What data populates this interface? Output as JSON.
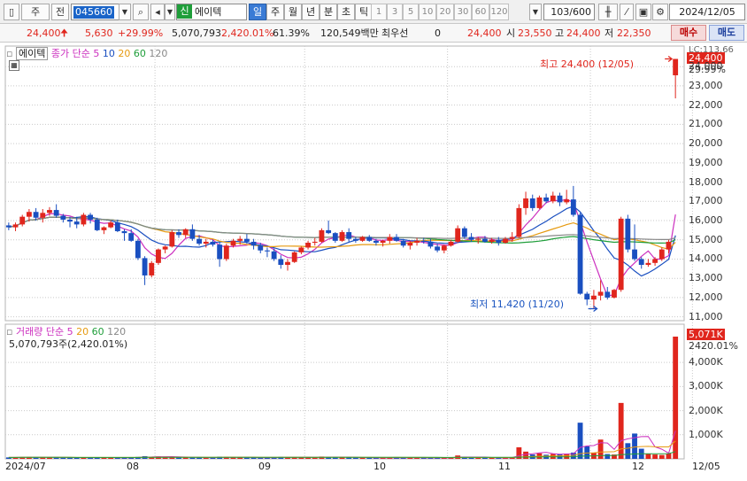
{
  "toolbar": {
    "market": "주",
    "scope": "전",
    "code": "045660",
    "stock_badge": "신",
    "stock_name": "에이텍",
    "periods": [
      "일",
      "주",
      "월",
      "년",
      "분",
      "초",
      "틱"
    ],
    "active_period": "일",
    "minutes": [
      "1",
      "3",
      "5",
      "10",
      "20",
      "30",
      "60",
      "120"
    ],
    "count_display": "103/600",
    "date": "2024/12/05"
  },
  "quote": {
    "price": "24,400",
    "change": "5,630",
    "change_pct": "+29.99%",
    "volume": "5,070,793",
    "volume_pct": "2,420.01%",
    "turnover": "61.39%",
    "amount": "120,549백만",
    "priority_label": "최우선",
    "priority_value": "0",
    "current": "24,400",
    "open_label": "시",
    "open": "23,550",
    "high_label": "고",
    "high": "24,400",
    "low_label": "저",
    "low": "22,350",
    "buy": "매수",
    "sell": "매도"
  },
  "price_panel": {
    "name": "에이텍",
    "ma_type": "종가 단순",
    "ma_periods": [
      "5",
      "10",
      "20",
      "60",
      "120"
    ],
    "ma_colors": [
      "#cc2fbf",
      "#1a4fc0",
      "#e69a10",
      "#1f9e3a",
      "#888888"
    ],
    "high_note": "최고 24,400 (12/05)",
    "low_note": "최저 11,420 (11/20)",
    "axis_ticks": [
      "24,000",
      "23,000",
      "22,000",
      "21,000",
      "20,000",
      "19,000",
      "18,000",
      "17,000",
      "16,000",
      "15,000",
      "14,000",
      "13,000",
      "12,000",
      "11,000"
    ],
    "lc_label": "LC:113.66",
    "current_tag": "24,400",
    "pct_tag": "29.99%"
  },
  "volume_panel": {
    "title": "거래량",
    "ma_type": "단순",
    "ma_periods": [
      "5",
      "20",
      "60",
      "120"
    ],
    "ma_colors": [
      "#cc2fbf",
      "#e69a10",
      "#1f9e3a",
      "#888888"
    ],
    "summary": "5,070,793주(2,420.01%)",
    "current_tag": "5,071K",
    "pct_tag": "2420.01%",
    "axis_ticks": [
      "4,000K",
      "3,000K",
      "2,000K",
      "1,000K"
    ]
  },
  "x_axis": [
    "2024/07",
    "08",
    "09",
    "10",
    "11",
    "12",
    "12/05"
  ],
  "chart_data": {
    "type": "candlestick",
    "series_name": "에이텍",
    "y_range": [
      10800,
      24700
    ],
    "volume_range": [
      0,
      5071
    ],
    "candles": [
      [
        15750,
        15900,
        15500,
        15650
      ],
      [
        15650,
        15900,
        15450,
        15800
      ],
      [
        15800,
        16300,
        15700,
        16200
      ],
      [
        16200,
        16600,
        15950,
        16450
      ],
      [
        16450,
        16650,
        16000,
        16150
      ],
      [
        16150,
        16600,
        15900,
        16400
      ],
      [
        16400,
        16700,
        16250,
        16550
      ],
      [
        16550,
        16850,
        16150,
        16250
      ],
      [
        16250,
        16350,
        15900,
        16050
      ],
      [
        16050,
        16200,
        15650,
        15950
      ],
      [
        15950,
        16200,
        15600,
        15800
      ],
      [
        15800,
        16400,
        15700,
        16300
      ],
      [
        16300,
        16400,
        15850,
        16050
      ],
      [
        16050,
        16150,
        15450,
        15500
      ],
      [
        15500,
        15700,
        15300,
        15650
      ],
      [
        15650,
        16000,
        15600,
        15900
      ],
      [
        15900,
        16050,
        15400,
        15450
      ],
      [
        15450,
        15550,
        14950,
        15350
      ],
      [
        15350,
        15550,
        14900,
        14950
      ],
      [
        14950,
        15050,
        13950,
        14050
      ],
      [
        14050,
        14150,
        12650,
        13150
      ],
      [
        13150,
        13900,
        13050,
        13800
      ],
      [
        13800,
        14550,
        13700,
        14500
      ],
      [
        14500,
        14700,
        14300,
        14650
      ],
      [
        14650,
        15500,
        14600,
        15400
      ],
      [
        15400,
        15550,
        15100,
        15250
      ],
      [
        15250,
        15600,
        15100,
        15550
      ],
      [
        15550,
        15800,
        14950,
        15050
      ],
      [
        15050,
        15250,
        14700,
        14800
      ],
      [
        14800,
        15050,
        14600,
        14900
      ],
      [
        14900,
        15000,
        14650,
        14750
      ],
      [
        14750,
        14900,
        13600,
        14000
      ],
      [
        14000,
        14800,
        13900,
        14700
      ],
      [
        14700,
        15050,
        14600,
        14950
      ],
      [
        14950,
        15200,
        14750,
        15050
      ],
      [
        15050,
        15300,
        14800,
        14900
      ],
      [
        14900,
        15050,
        14500,
        14700
      ],
      [
        14700,
        14850,
        14300,
        14450
      ],
      [
        14450,
        14600,
        14100,
        14400
      ],
      [
        14400,
        14550,
        13900,
        14000
      ],
      [
        14000,
        14200,
        13500,
        13700
      ],
      [
        13700,
        14000,
        13400,
        13850
      ],
      [
        13850,
        14400,
        13800,
        14350
      ],
      [
        14350,
        14650,
        14250,
        14600
      ],
      [
        14600,
        14950,
        14500,
        14850
      ],
      [
        14850,
        15100,
        14700,
        14900
      ],
      [
        14900,
        15600,
        14850,
        15500
      ],
      [
        15500,
        16000,
        15300,
        15350
      ],
      [
        15350,
        15400,
        14850,
        14950
      ],
      [
        14950,
        15500,
        14900,
        15400
      ],
      [
        15400,
        15600,
        14900,
        15050
      ],
      [
        15050,
        15150,
        14850,
        14950
      ],
      [
        14950,
        15200,
        14900,
        15150
      ],
      [
        15150,
        15250,
        14900,
        14950
      ],
      [
        14950,
        15050,
        14700,
        14850
      ],
      [
        14850,
        15000,
        14650,
        14950
      ],
      [
        14950,
        15300,
        14800,
        15150
      ],
      [
        15150,
        15300,
        14900,
        14950
      ],
      [
        14950,
        15050,
        14600,
        14700
      ],
      [
        14700,
        14950,
        14500,
        14850
      ],
      [
        14850,
        15100,
        14700,
        14950
      ],
      [
        14950,
        15100,
        14800,
        14900
      ],
      [
        14900,
        15050,
        14550,
        14650
      ],
      [
        14650,
        14800,
        14350,
        14450
      ],
      [
        14450,
        14750,
        14300,
        14700
      ],
      [
        14700,
        15000,
        14650,
        14900
      ],
      [
        14900,
        15750,
        14850,
        15600
      ],
      [
        15600,
        15700,
        15050,
        15150
      ],
      [
        15150,
        15350,
        14900,
        15000
      ],
      [
        15000,
        15150,
        14800,
        15050
      ],
      [
        15050,
        15200,
        14850,
        14900
      ],
      [
        14900,
        15100,
        14800,
        15000
      ],
      [
        15000,
        15150,
        14700,
        14850
      ],
      [
        14850,
        15150,
        14800,
        15050
      ],
      [
        15050,
        15400,
        14900,
        15150
      ],
      [
        15150,
        16850,
        15100,
        16650
      ],
      [
        16650,
        17500,
        16300,
        17150
      ],
      [
        17150,
        17350,
        16500,
        16650
      ],
      [
        16650,
        17300,
        16600,
        17200
      ],
      [
        17200,
        17400,
        16900,
        17000
      ],
      [
        17000,
        17500,
        16900,
        17300
      ],
      [
        17300,
        17450,
        16750,
        16950
      ],
      [
        16950,
        17600,
        16850,
        17100
      ],
      [
        17100,
        17800,
        16200,
        16300
      ],
      [
        16300,
        16400,
        12150,
        12200
      ],
      [
        12200,
        12300,
        11600,
        11900
      ],
      [
        11900,
        12400,
        11420,
        12100
      ],
      [
        12100,
        12900,
        11850,
        12300
      ],
      [
        12300,
        12550,
        11900,
        12000
      ],
      [
        12000,
        12450,
        11950,
        12400
      ],
      [
        12400,
        16200,
        12300,
        16100
      ],
      [
        16100,
        16300,
        14350,
        14500
      ],
      [
        14500,
        15800,
        13900,
        14000
      ],
      [
        14000,
        14100,
        13500,
        13700
      ],
      [
        13700,
        14000,
        13600,
        13800
      ],
      [
        13800,
        14100,
        13650,
        14000
      ],
      [
        14000,
        14600,
        13900,
        14500
      ],
      [
        14500,
        15000,
        14300,
        14900
      ],
      [
        23550,
        24400,
        22350,
        24400
      ]
    ],
    "volume": [
      60,
      55,
      70,
      80,
      65,
      60,
      55,
      70,
      50,
      45,
      50,
      60,
      55,
      60,
      50,
      45,
      55,
      60,
      55,
      80,
      110,
      90,
      100,
      70,
      90,
      60,
      55,
      60,
      55,
      50,
      45,
      90,
      80,
      60,
      55,
      50,
      55,
      45,
      50,
      60,
      80,
      70,
      65,
      60,
      70,
      55,
      95,
      80,
      60,
      70,
      55,
      50,
      45,
      50,
      45,
      50,
      55,
      50,
      45,
      50,
      55,
      45,
      50,
      45,
      50,
      55,
      140,
      70,
      55,
      50,
      45,
      50,
      45,
      50,
      60,
      480,
      300,
      180,
      230,
      170,
      200,
      190,
      220,
      260,
      1500,
      520,
      260,
      800,
      200,
      180,
      2320,
      650,
      1050,
      420,
      200,
      180,
      160,
      220,
      5071
    ]
  }
}
